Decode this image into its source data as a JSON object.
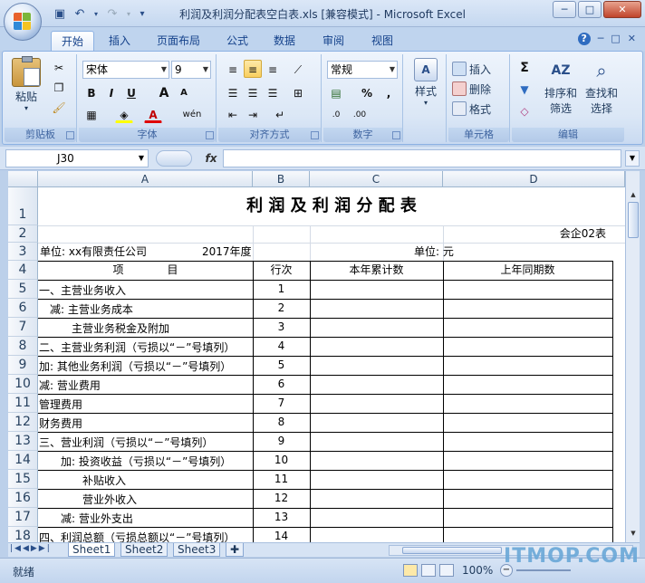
{
  "window": {
    "title": "利润及利润分配表空白表.xls  [兼容模式] - Microsoft Excel",
    "minimize": "─",
    "maximize": "□",
    "close": "✕"
  },
  "qat": {
    "dropdown": "▾"
  },
  "tabs": [
    "开始",
    "插入",
    "页面布局",
    "公式",
    "数据",
    "审阅",
    "视图"
  ],
  "ribbon_right": {
    "help": "?",
    "min": "─",
    "restore": "□",
    "close": "✕"
  },
  "ribbon": {
    "clipboard": {
      "label": "剪贴板",
      "paste": "粘贴"
    },
    "font": {
      "label": "字体",
      "name": "宋体",
      "size": "9",
      "bold": "B",
      "italic": "I",
      "underline": "U",
      "grow": "A",
      "shrink": "A",
      "wen": "wén",
      "fontcolor": "A"
    },
    "alignment": {
      "label": "对齐方式"
    },
    "number": {
      "label": "数字",
      "format": "常规",
      "percent": "%",
      "comma": ","
    },
    "styles": {
      "label": "样式"
    },
    "cells": {
      "label": "单元格",
      "insert": "插入",
      "delete": "删除",
      "format": "格式"
    },
    "editing": {
      "label": "编辑",
      "sigma": "Σ",
      "sort": "排序和",
      "sort2": "筛选",
      "find": "查找和",
      "find2": "选择"
    }
  },
  "formula_bar": {
    "namebox": "J30",
    "fx": "fx",
    "content": ""
  },
  "columns": [
    "A",
    "B",
    "C",
    "D"
  ],
  "rows": [
    "1",
    "2",
    "3",
    "4",
    "5",
    "6",
    "7",
    "8",
    "9",
    "10",
    "11",
    "12",
    "13",
    "14",
    "15",
    "16",
    "17",
    "18"
  ],
  "sheet": {
    "title": "利 润 及 利 润 分 配 表",
    "form_no": "会企02表",
    "unit_company": "单位: xx有限责任公司",
    "year": "2017年度",
    "unit_money": "单位: 元",
    "headers": [
      "项　　　　目",
      "行次",
      "本年累计数",
      "上年同期数"
    ],
    "items": [
      {
        "label": "一、主营业务收入",
        "no": "1"
      },
      {
        "label": "　减: 主营业务成本",
        "no": "2"
      },
      {
        "label": "　　　主营业务税金及附加",
        "no": "3"
      },
      {
        "label": "二、主营业务利润（亏损以“－”号填列）",
        "no": "4"
      },
      {
        "label": "加: 其他业务利润（亏损以“－”号填列）",
        "no": "5"
      },
      {
        "label": "减: 营业费用",
        "no": "6"
      },
      {
        "label": "管理费用",
        "no": "7"
      },
      {
        "label": "财务费用",
        "no": "8"
      },
      {
        "label": "三、营业利润（亏损以“－”号填列）",
        "no": "9"
      },
      {
        "label": "　　加: 投资收益（亏损以“－”号填列）",
        "no": "10"
      },
      {
        "label": "　　　　补贴收入",
        "no": "11"
      },
      {
        "label": "　　　　营业外收入",
        "no": "12"
      },
      {
        "label": "　　减: 营业外支出",
        "no": "13"
      },
      {
        "label": "四、利润总额（亏损总额以“－”号填列）",
        "no": "14"
      }
    ]
  },
  "sheet_tabs": [
    "Sheet1",
    "Sheet2",
    "Sheet3"
  ],
  "status": {
    "ready": "就绪",
    "zoom": "100%"
  },
  "watermark": "ITMOP.COM"
}
